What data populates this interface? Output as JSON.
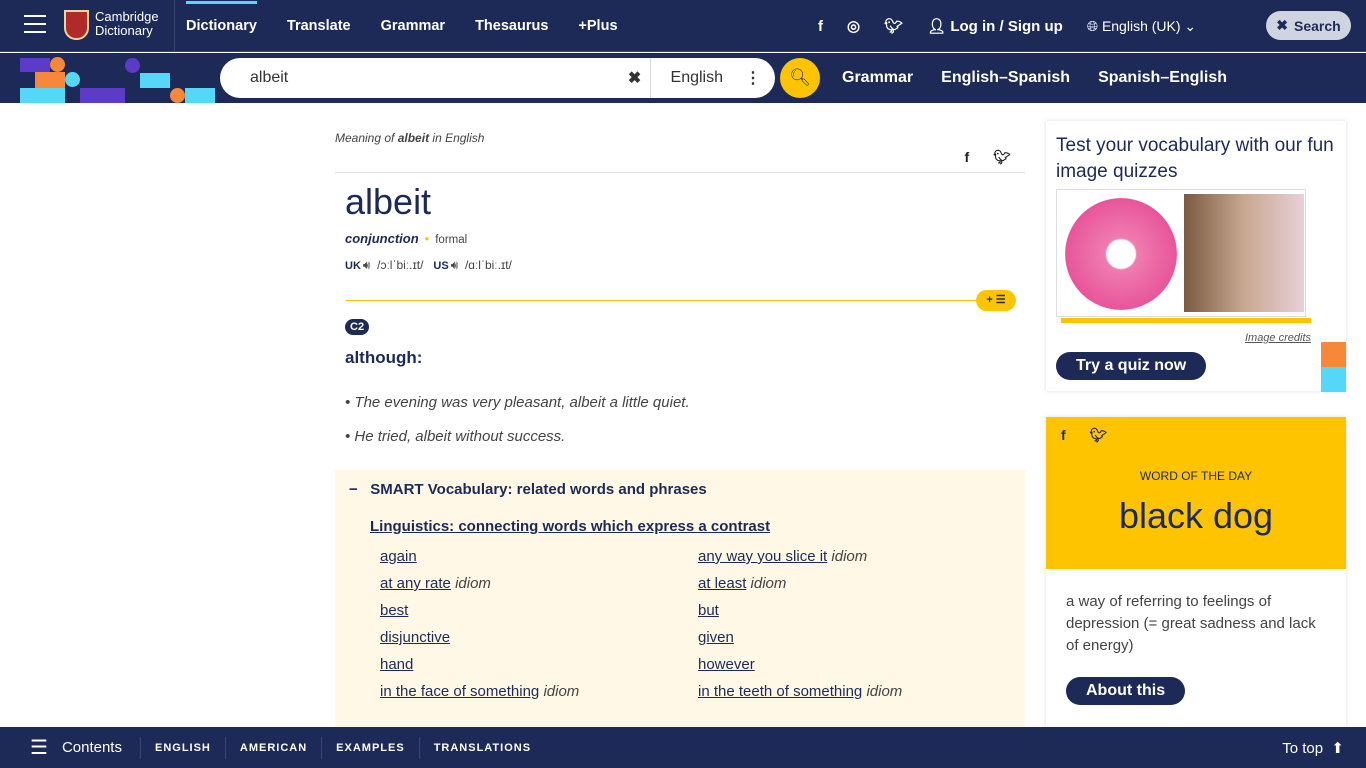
{
  "header": {
    "logo": [
      "Cambridge",
      "Dictionary"
    ],
    "nav": [
      "Dictionary",
      "Translate",
      "Grammar",
      "Thesaurus",
      "+Plus"
    ],
    "login": "Log in / Sign up",
    "language": "English (UK)",
    "search_button": "Search"
  },
  "searchbar": {
    "value": "albeit",
    "dataset": "English",
    "links": [
      "Grammar",
      "English–Spanish",
      "Spanish–English"
    ]
  },
  "colors": {
    "navy": "#1d2a57",
    "yellow": "#fec400",
    "cream": "#fff8e6"
  },
  "entry": {
    "meaning_prefix": "Meaning of ",
    "meaning_word": "albeit",
    "meaning_suffix": " in English",
    "headword": "albeit",
    "pos": "conjunction",
    "register": "formal",
    "uk_label": "UK",
    "uk_ipa": "/ɔːlˈbiː.ɪt/",
    "us_label": "US",
    "us_ipa": "/ɑːlˈbiː.ɪt/",
    "level": "C2",
    "definition": "although:",
    "examples": [
      "The evening was very pleasant, albeit a little quiet.",
      "He tried, albeit without success."
    ]
  },
  "smart": {
    "heading": "SMART Vocabulary: related words and phrases",
    "topic": "Linguistics: connecting words which express a contrast",
    "items": [
      {
        "w": "again",
        "t": ""
      },
      {
        "w": "any way you slice it",
        "t": "idiom"
      },
      {
        "w": "at any rate",
        "t": "idiom"
      },
      {
        "w": "at least",
        "t": "idiom"
      },
      {
        "w": "best",
        "t": ""
      },
      {
        "w": "but",
        "t": ""
      },
      {
        "w": "disjunctive",
        "t": ""
      },
      {
        "w": "given",
        "t": ""
      },
      {
        "w": "hand",
        "t": ""
      },
      {
        "w": "however",
        "t": ""
      },
      {
        "w": "in the face of something",
        "t": "idiom"
      },
      {
        "w": "in the teeth of something",
        "t": "idiom"
      }
    ]
  },
  "quiz": {
    "title": "Test your vocabulary with our fun image quizzes",
    "credits": "Image credits",
    "button": "Try a quiz now"
  },
  "wotd": {
    "label": "WORD OF THE DAY",
    "word": "black dog",
    "definition": "a way of referring to feelings of depression (= great sadness and lack of energy)",
    "button": "About this"
  },
  "bottom": {
    "contents": "Contents",
    "tabs": [
      "ENGLISH",
      "AMERICAN",
      "EXAMPLES",
      "TRANSLATIONS"
    ],
    "to_top": "To top"
  }
}
